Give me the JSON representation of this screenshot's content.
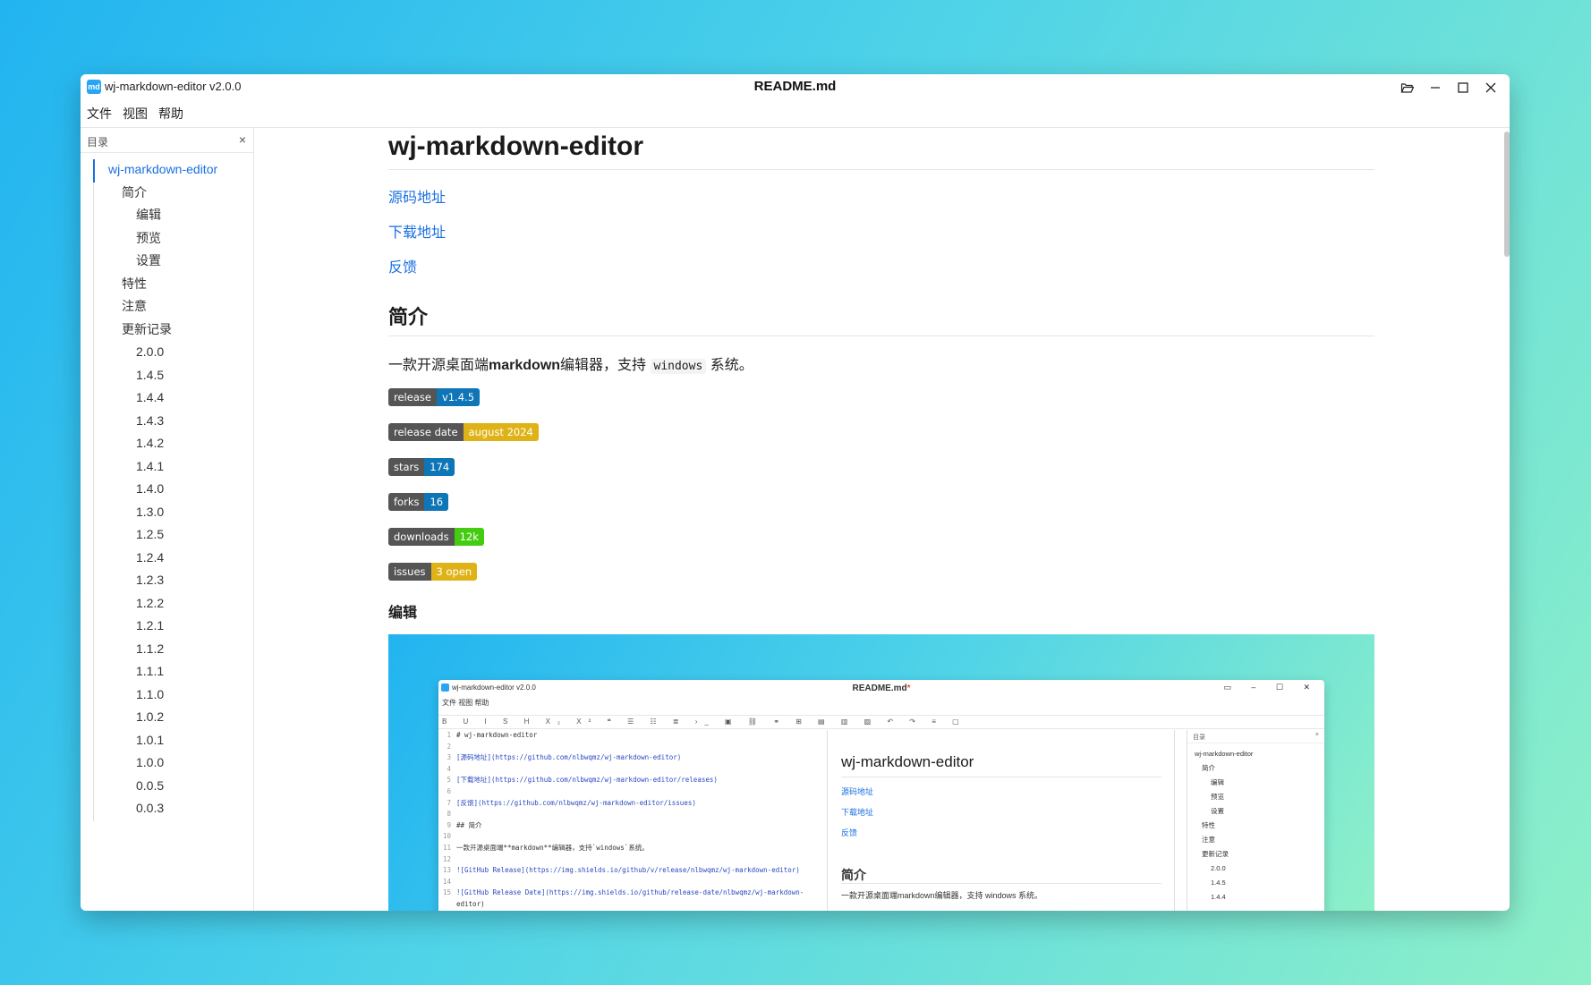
{
  "window": {
    "app_logo": "md",
    "app_title": "wj-markdown-editor v2.0.0",
    "doc_title": "README.md",
    "buttons": [
      "folder-open-icon",
      "minimize-icon",
      "maximize-icon",
      "close-icon"
    ]
  },
  "menu": [
    "文件",
    "视图",
    "帮助"
  ],
  "toc": {
    "title": "目录",
    "close": "×",
    "items": [
      {
        "label": "wj-markdown-editor",
        "level": 1
      },
      {
        "label": "简介",
        "level": 2
      },
      {
        "label": "编辑",
        "level": 3
      },
      {
        "label": "预览",
        "level": 3
      },
      {
        "label": "设置",
        "level": 3
      },
      {
        "label": "特性",
        "level": 2
      },
      {
        "label": "注意",
        "level": 2
      },
      {
        "label": "更新记录",
        "level": 2
      },
      {
        "label": "2.0.0",
        "level": 3
      },
      {
        "label": "1.4.5",
        "level": 3
      },
      {
        "label": "1.4.4",
        "level": 3
      },
      {
        "label": "1.4.3",
        "level": 3
      },
      {
        "label": "1.4.2",
        "level": 3
      },
      {
        "label": "1.4.1",
        "level": 3
      },
      {
        "label": "1.4.0",
        "level": 3
      },
      {
        "label": "1.3.0",
        "level": 3
      },
      {
        "label": "1.2.5",
        "level": 3
      },
      {
        "label": "1.2.4",
        "level": 3
      },
      {
        "label": "1.2.3",
        "level": 3
      },
      {
        "label": "1.2.2",
        "level": 3
      },
      {
        "label": "1.2.1",
        "level": 3
      },
      {
        "label": "1.1.2",
        "level": 3
      },
      {
        "label": "1.1.1",
        "level": 3
      },
      {
        "label": "1.1.0",
        "level": 3
      },
      {
        "label": "1.0.2",
        "level": 3
      },
      {
        "label": "1.0.1",
        "level": 3
      },
      {
        "label": "1.0.0",
        "level": 3
      },
      {
        "label": "0.0.5",
        "level": 3
      },
      {
        "label": "0.0.3",
        "level": 3
      }
    ]
  },
  "article": {
    "h1": "wj-markdown-editor",
    "links": [
      "源码地址",
      "下载地址",
      "反馈"
    ],
    "h2_intro": "简介",
    "intro_before": "一款开源桌面端",
    "intro_bold": "markdown",
    "intro_mid": "编辑器，支持",
    "intro_code": "windows",
    "intro_after": "系统。",
    "badges": [
      {
        "label": "release",
        "value": "v1.4.5",
        "color": "#0e75b6"
      },
      {
        "label": "release date",
        "value": "august 2024",
        "color": "#dfb317"
      },
      {
        "label": "stars",
        "value": "174",
        "color": "#0e75b6"
      },
      {
        "label": "forks",
        "value": "16",
        "color": "#0e75b6"
      },
      {
        "label": "downloads",
        "value": "12k",
        "color": "#4c1"
      },
      {
        "label": "issues",
        "value": "3 open",
        "color": "#dfb317"
      }
    ],
    "h3_edit": "编辑"
  },
  "screenshot": {
    "app_title": "wj-markdown-editor v2.0.0",
    "doc_title": "README.md",
    "dirty_mark": "*",
    "menu": "文件  视图  帮助",
    "toolbar": "B U I S H X₂ X² ❝ ☰ ☷ ≣ ›_ ▣ ⛓ ⚭ ⊞ ▤ ▥ ▨ ↶ ↷ ≡ ▢",
    "editor_lines": [
      "# wj-markdown-editor",
      "",
      "[源码地址](https://github.com/nlbwqmz/wj-markdown-editor)",
      "",
      "[下载地址](https://github.com/nlbwqmz/wj-markdown-editor/releases)",
      "",
      "[反馈](https://github.com/nlbwqmz/wj-markdown-editor/issues)",
      "",
      "## 简介",
      "",
      "一款开源桌面端**markdown**编辑器，支持`windows`系统。",
      "",
      "![GitHub Release](https://img.shields.io/github/v/release/nlbwqmz/wj-markdown-editor)",
      "",
      "![GitHub Release Date](https://img.shields.io/github/release-date/nlbwqmz/wj-markdown-",
      "editor)"
    ],
    "preview_h1": "wj-markdown-editor",
    "preview_links": [
      "源码地址",
      "下载地址",
      "反馈"
    ],
    "preview_h2": "简介",
    "preview_para": "一款开源桌面端markdown编辑器，支持 windows 系统。",
    "toc_title": "目录",
    "toc_close": "×",
    "toc_items": [
      {
        "label": "wj-markdown-editor",
        "level": 1
      },
      {
        "label": "简介",
        "level": 2
      },
      {
        "label": "编辑",
        "level": 3
      },
      {
        "label": "预览",
        "level": 3
      },
      {
        "label": "设置",
        "level": 3
      },
      {
        "label": "特性",
        "level": 2
      },
      {
        "label": "注意",
        "level": 2
      },
      {
        "label": "更新记录",
        "level": 2
      },
      {
        "label": "2.0.0",
        "level": 3
      },
      {
        "label": "1.4.5",
        "level": 3
      },
      {
        "label": "1.4.4",
        "level": 3
      }
    ]
  }
}
